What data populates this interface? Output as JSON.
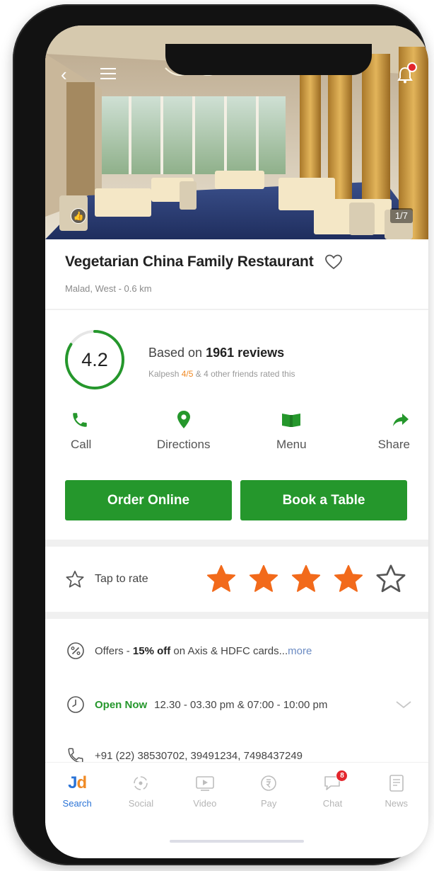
{
  "restaurant": {
    "name": "Vegetarian China Family Restaurant",
    "location": "Malad, West - 0.6 km",
    "photo_counter": "1/7"
  },
  "rating": {
    "value": 4.2,
    "value_text": "4.2",
    "reviews_prefix": "Based on",
    "reviews_count": "1961 reviews",
    "friend_name": "Kalpesh",
    "friend_score": "4/5",
    "friends_rest": "& 4 other friends rated this"
  },
  "actions": [
    {
      "label": "Call",
      "icon": "phone-icon"
    },
    {
      "label": "Directions",
      "icon": "map-pin-icon"
    },
    {
      "label": "Menu",
      "icon": "book-icon"
    },
    {
      "label": "Share",
      "icon": "share-arrow-icon"
    }
  ],
  "cta": {
    "order_online": "Order Online",
    "book_table": "Book a Table"
  },
  "rate": {
    "label": "Tap to rate",
    "stars_filled": 4,
    "stars_total": 5
  },
  "offers": {
    "prefix": "Offers -",
    "highlight": "15% off",
    "rest": "on Axis & HDFC cards...",
    "more": "more"
  },
  "hours": {
    "status": "Open Now",
    "times": "12.30 - 03.30 pm & 07:00 - 10:00 pm"
  },
  "phone": {
    "numbers": "+91 (22) 38530702, 39491234, 7498437249"
  },
  "tabs": [
    {
      "label": "Search",
      "icon": "jd-logo-icon",
      "active": true
    },
    {
      "label": "Social",
      "icon": "social-icon"
    },
    {
      "label": "Video",
      "icon": "video-icon"
    },
    {
      "label": "Pay",
      "icon": "pay-icon"
    },
    {
      "label": "Chat",
      "icon": "chat-icon",
      "badge": "8"
    },
    {
      "label": "News",
      "icon": "news-icon"
    }
  ],
  "jd_logo": {
    "j": "J",
    "d": "d"
  },
  "colors": {
    "primary_green": "#25972c",
    "accent_orange": "#f08a24",
    "star_orange": "#f26a1b",
    "link_blue": "#6b8bc3",
    "tab_active_blue": "#2a73d6",
    "badge_red": "#e3262d"
  }
}
